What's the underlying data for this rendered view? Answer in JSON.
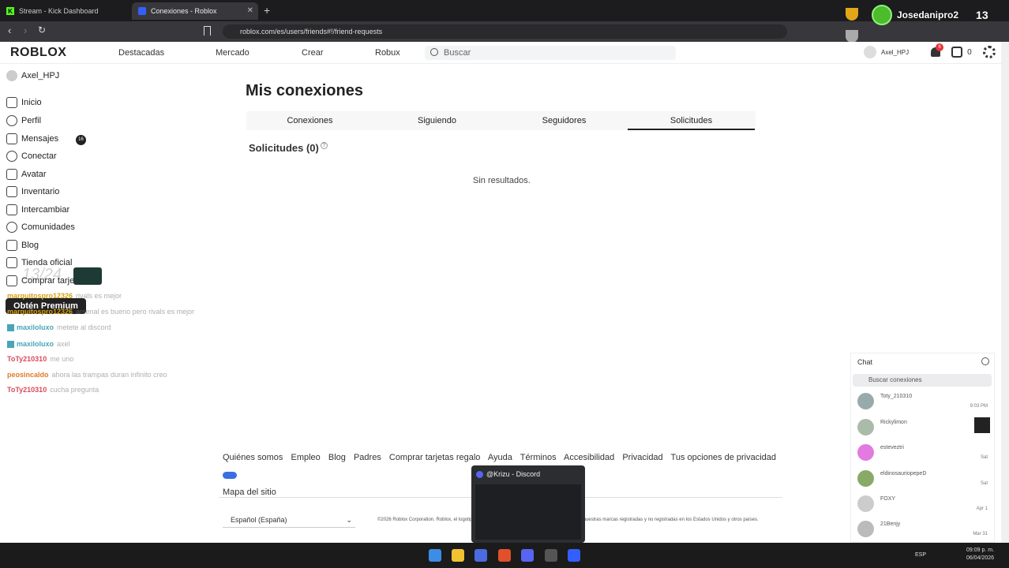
{
  "browser": {
    "tabs": [
      {
        "title": "Stream - Kick Dashboard"
      },
      {
        "title": "Conexiones - Roblox"
      }
    ],
    "url": "roblox.com/es/users/friends#!/friend-requests"
  },
  "stream_overlay": {
    "username": "Josedanipro2",
    "count": "13",
    "ghost_text": "13/24",
    "chat": [
      {
        "user": "marquitospro12326",
        "message": "rivals es mejor",
        "color": "#d4a017"
      },
      {
        "user": "marquitospro12326",
        "message": "arsenal es bueno pero rivals es mejor",
        "color": "#d4a017"
      },
      {
        "user": "maxiloluxo",
        "message": "metete al discord",
        "color": "#4aa5b8"
      },
      {
        "user": "maxiloluxo",
        "message": "axel",
        "color": "#4aa5b8"
      },
      {
        "user": "ToTy210310",
        "message": "me uno",
        "color": "#d94a5a"
      },
      {
        "user": "peosincaldo",
        "message": "ahora las trampas duran infinito creo",
        "color": "#e07a2a"
      },
      {
        "user": "ToTy210310",
        "message": "cucha pregunta",
        "color": "#d94a5a"
      }
    ]
  },
  "header": {
    "logo": "ROBLOX",
    "nav": [
      "Destacadas",
      "Mercado",
      "Crear",
      "Robux"
    ],
    "search_placeholder": "Buscar",
    "username": "Axel_HPJ",
    "notif_count": "6",
    "robux": "0"
  },
  "sidebar": {
    "username": "Axel_HPJ",
    "items": [
      {
        "label": "Inicio"
      },
      {
        "label": "Perfil"
      },
      {
        "label": "Mensajes"
      },
      {
        "label": "Conectar"
      },
      {
        "label": "Avatar"
      },
      {
        "label": "Inventario"
      },
      {
        "label": "Intercambiar"
      },
      {
        "label": "Comunidades"
      },
      {
        "label": "Blog"
      },
      {
        "label": "Tienda oficial"
      },
      {
        "label": "Comprar tarjeta"
      }
    ],
    "messages_badge": "16",
    "premium": "Obtén Premium"
  },
  "main": {
    "title": "Mis conexiones",
    "tabs": [
      "Conexiones",
      "Siguiendo",
      "Seguidores",
      "Solicitudes"
    ],
    "section_title": "Solicitudes (0)",
    "empty": "Sin resultados."
  },
  "footer": {
    "links": [
      "Quiénes somos",
      "Empleo",
      "Blog",
      "Padres",
      "Comprar tarjetas regalo",
      "Ayuda",
      "Términos",
      "Accesibilidad",
      "Privacidad",
      "Tus opciones de privacidad",
      "Mapa del sitio"
    ],
    "language": "Español (España)",
    "copyright": "©2026 Roblox Corporation. Roblox, el logotipo de Roblox y Powering Imagination son algunas de nuestras marcas registradas y no registradas en los Estados Unidos y otros países."
  },
  "discord_preview": {
    "title": "@Krizu - Discord"
  },
  "chat_panel": {
    "title": "Chat",
    "search_placeholder": "Buscar conexiones",
    "contacts": [
      {
        "name": "Toty_210310",
        "time": "9:03 PM"
      },
      {
        "name": "Rickylimon",
        "time": ""
      },
      {
        "name": "esteveztri",
        "time": "Sat"
      },
      {
        "name": "eldinosauriopepeD",
        "time": "Sat"
      },
      {
        "name": "FOXY",
        "time": "Apr 1"
      },
      {
        "name": "21Benjy",
        "time": "Mar 31"
      }
    ]
  },
  "taskbar": {
    "lang": "ESP",
    "time": "09:09 p. m.",
    "date": "06/04/2026"
  }
}
